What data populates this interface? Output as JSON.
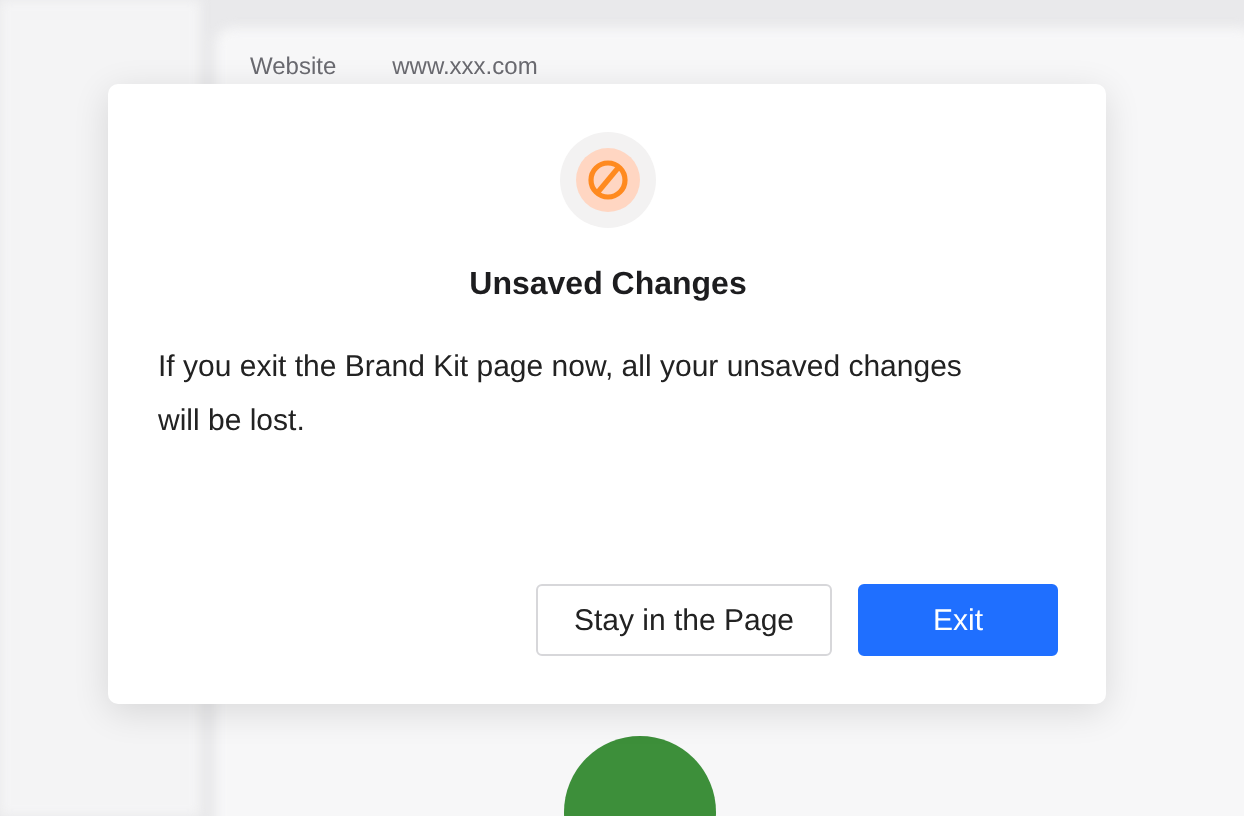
{
  "background": {
    "field_label": "Website",
    "field_value": "www.xxx.com"
  },
  "dialog": {
    "title": "Unsaved Changes",
    "message": "If you exit the Brand Kit page now, all your unsaved changes will be lost.",
    "buttons": [
      {
        "label": "Stay in the Page",
        "kind": "secondary"
      },
      {
        "label": "Exit",
        "kind": "primary"
      }
    ]
  }
}
